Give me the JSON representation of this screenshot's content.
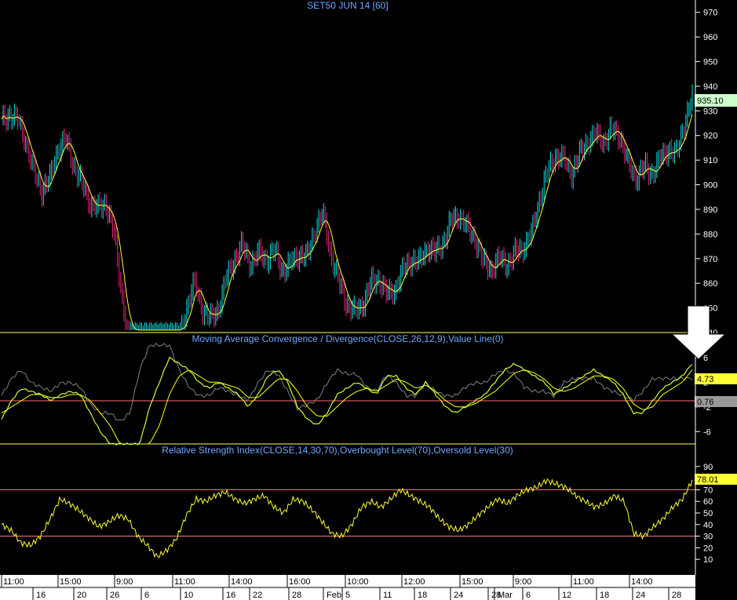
{
  "colors": {
    "background": "#000000",
    "grid": "#3a3a3a",
    "candle_up": "#00e5e5",
    "candle_down": "#e8257a",
    "ma": "#ffff33",
    "macd_line": "#ccff33",
    "signal_line": "#ffff00",
    "histogram": "#808080",
    "zero_line": "#ff6b6b",
    "rsi_line": "#ffff33",
    "level_line": "#ff8080",
    "panel_border": "#ffff66",
    "axis_bg": "#ffffff",
    "price_box": "#ccffcc",
    "macd_box": "#ffff33",
    "signal_box": "#999999",
    "rsi_box": "#ffff33",
    "panel_title": "#6fa8ff"
  },
  "chart_data": [
    {
      "type": "candlestick",
      "title": "SET50 JUN 14   [60]",
      "ylim": [
        840,
        975
      ],
      "y_ticks": [
        "970",
        "960",
        "950",
        "940",
        "930",
        "920",
        "910",
        "900",
        "890",
        "880",
        "870",
        "860",
        "850",
        "840"
      ],
      "last_value": "935.10",
      "close_series": [
        925,
        929,
        926,
        918,
        905,
        898,
        902,
        915,
        918,
        908,
        900,
        893,
        890,
        893,
        880,
        855,
        832,
        800,
        775,
        760,
        775,
        805,
        835,
        850,
        860,
        850,
        845,
        850,
        862,
        870,
        875,
        868,
        872,
        870,
        873,
        865,
        868,
        872,
        870,
        882,
        888,
        872,
        860,
        852,
        848,
        852,
        860,
        862,
        855,
        858,
        865,
        870,
        868,
        875,
        872,
        877,
        885,
        888,
        882,
        878,
        868,
        866,
        870,
        868,
        872,
        875,
        880,
        895,
        905,
        912,
        910,
        905,
        912,
        918,
        920,
        918,
        922,
        920,
        908,
        903,
        907,
        905,
        910,
        915,
        912,
        925,
        935
      ]
    },
    {
      "type": "line",
      "title": "Moving Average Convergence / Divergence(CLOSE,26,12,9),Value Line(0)",
      "ylim": [
        -8,
        8
      ],
      "y_ticks": [
        "6",
        "2",
        "-2",
        "-6"
      ],
      "macd_value": "4.73",
      "signal_value": "0.76",
      "macd": [
        -4,
        -1,
        1,
        0.5,
        0,
        -1,
        0,
        0.5,
        0,
        -3,
        -6,
        -8,
        -12,
        -14,
        -10,
        -2,
        2,
        6,
        5,
        4,
        2,
        1,
        2,
        1,
        0,
        -2,
        0,
        3,
        4,
        2,
        -2,
        -4,
        -5,
        -3,
        0,
        1,
        2,
        1,
        0,
        3,
        3,
        1,
        0,
        2,
        0,
        -2,
        -3,
        -2,
        -1,
        0,
        2,
        4,
        5,
        4,
        3,
        2,
        0,
        1,
        2,
        3,
        4,
        3,
        2,
        0,
        -3,
        -3,
        -1,
        1,
        2,
        3,
        5
      ],
      "signal": [
        -3,
        -2,
        -1,
        0,
        0,
        -0.5,
        -0.5,
        0,
        0,
        -1,
        -3,
        -5,
        -8,
        -11,
        -12,
        -9,
        -5,
        0,
        3,
        4,
        3,
        2,
        2,
        1.5,
        1,
        -0.5,
        -0.5,
        1,
        2.5,
        2.5,
        0.5,
        -2,
        -3.5,
        -3.5,
        -2,
        -0.5,
        0.5,
        1,
        0.5,
        1.5,
        2.5,
        2,
        1,
        1.5,
        0.5,
        -1,
        -2,
        -2,
        -1.5,
        -0.5,
        0.5,
        2,
        3.5,
        4,
        3.5,
        2.5,
        1,
        0.5,
        1,
        2,
        3,
        3,
        2.5,
        1,
        -1.5,
        -2.5,
        -2,
        0,
        1,
        2,
        4
      ]
    },
    {
      "type": "line",
      "title": "Relative Strength Index(CLOSE,14,30,70),Overbought Level(70),Oversold Level(30)",
      "ylim": [
        0,
        100
      ],
      "y_ticks": [
        "90",
        "80",
        "70",
        "60",
        "50",
        "40",
        "30",
        "20",
        "10"
      ],
      "levels": [
        70,
        30
      ],
      "last_value": "78.01",
      "values": [
        40,
        35,
        24,
        22,
        30,
        45,
        62,
        58,
        52,
        45,
        38,
        42,
        48,
        45,
        30,
        22,
        12,
        18,
        28,
        48,
        62,
        60,
        65,
        68,
        62,
        58,
        62,
        65,
        55,
        50,
        62,
        60,
        52,
        42,
        32,
        30,
        40,
        55,
        60,
        55,
        62,
        70,
        65,
        60,
        55,
        45,
        38,
        35,
        40,
        48,
        55,
        62,
        58,
        65,
        70,
        72,
        78,
        75,
        72,
        65,
        60,
        55,
        58,
        65,
        60,
        32,
        30,
        38,
        45,
        55,
        62,
        78
      ]
    }
  ],
  "x_axis": {
    "time_labels": [
      "11:00",
      "15:00",
      "9:00",
      "11:00",
      "14:00",
      "16:00",
      "10:00",
      "12:00",
      "15:00",
      "9:00",
      "11:00",
      "14:00"
    ],
    "date_labels": [
      "16",
      "20",
      "26",
      "6",
      "10",
      "16",
      "22",
      "28",
      "Feb",
      "5",
      "11",
      "18",
      "24",
      "28",
      "Mar",
      "6",
      "12",
      "18",
      "24",
      "28"
    ]
  }
}
